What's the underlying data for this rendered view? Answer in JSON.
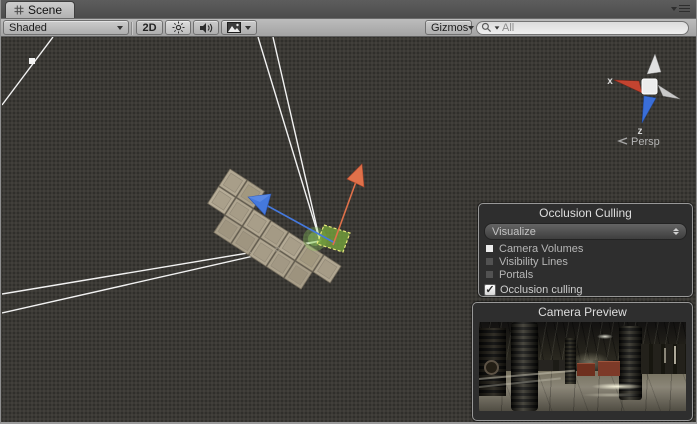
{
  "window": {
    "tab_label": "Scene"
  },
  "toolbar": {
    "draw_mode": "Shaded",
    "btn_2d": "2D",
    "gizmos_label": "Gizmos",
    "search_placeholder": "All"
  },
  "scene": {
    "axis_gizmo": {
      "x_label": "x",
      "z_label": "z",
      "projection": "Persp"
    }
  },
  "occlusion_panel": {
    "title": "Occlusion Culling",
    "mode": "Visualize",
    "items": [
      {
        "label": "Camera Volumes",
        "state": "on"
      },
      {
        "label": "Visibility Lines",
        "state": "off"
      },
      {
        "label": "Portals",
        "state": "off"
      }
    ],
    "checkbox": {
      "label": "Occlusion culling",
      "checked": true,
      "glyph": "✓"
    }
  },
  "camera_preview": {
    "title": "Camera Preview"
  },
  "colors": {
    "viewport_bg": "#3b3935",
    "frustum_line": "#f2f2f2",
    "move_axis_orange": "#e0714a",
    "move_axis_blue": "#4579dd",
    "plane_handle_green": "#78a33c",
    "plane_handle_outline": "#e6e87a",
    "axis_gizmo_red": "#c44430",
    "axis_gizmo_blue": "#3a6ed8",
    "model_tan": "#b2a893"
  }
}
